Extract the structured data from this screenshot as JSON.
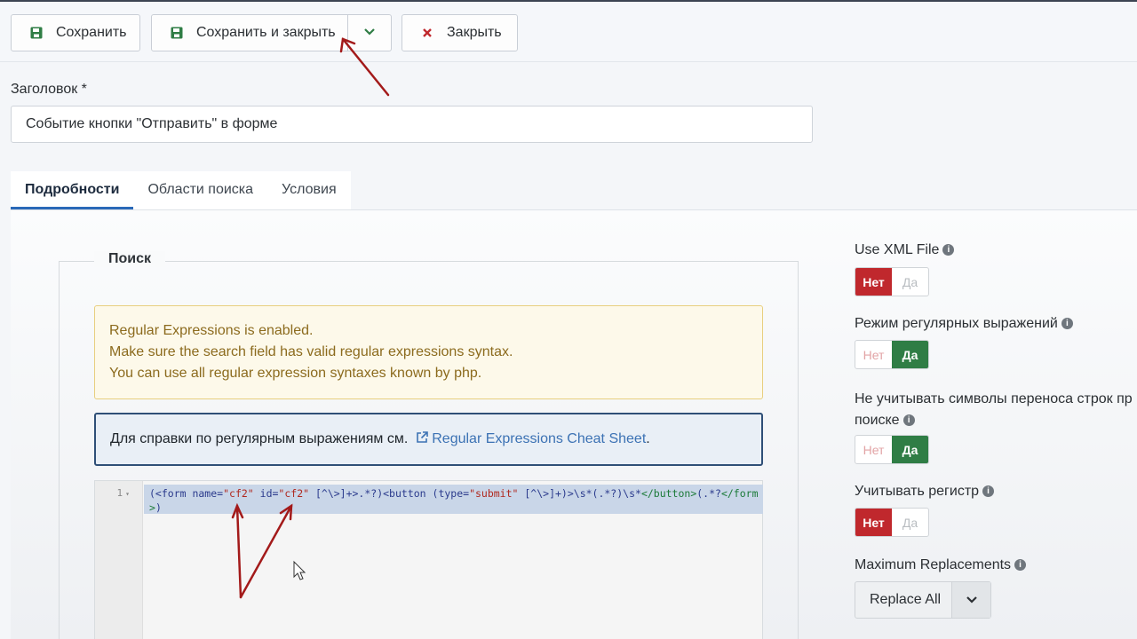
{
  "toolbar": {
    "save_label": "Сохранить",
    "save_close_label": "Сохранить и закрыть",
    "close_label": "Закрыть"
  },
  "title_field": {
    "label": "Заголовок *",
    "value": "Событие кнопки \"Отправить\" в форме"
  },
  "tabs": [
    {
      "label": "Подробности",
      "active": true
    },
    {
      "label": "Области поиска",
      "active": false
    },
    {
      "label": "Условия",
      "active": false
    }
  ],
  "search_fieldset": {
    "legend": "Поиск",
    "warning_lines": [
      "Regular Expressions is enabled.",
      "Make sure the search field has valid regular expressions syntax.",
      "You can use all regular expression syntaxes known by php."
    ],
    "info_text": "Для справки по регулярным выражениям см.",
    "info_link": "Regular Expressions Cheat Sheet",
    "info_after": "."
  },
  "editor": {
    "line_number": "1",
    "code": "(<form name=\"cf2\" id=\"cf2\" [^\\>]+>.*?)<button (type=\"submit\" [^\\>]+)>\\s*(.*?)\\s*</button>(.*?</form>)"
  },
  "options": {
    "use_xml_file": {
      "label": "Use XML File",
      "no": "Нет",
      "yes": "Да",
      "value": "no"
    },
    "regex_mode": {
      "label": "Режим регулярных выражений",
      "no": "Нет",
      "yes": "Да",
      "value": "yes"
    },
    "ignore_linebreaks": {
      "label_line1": "Не учитывать символы переноса строк пр",
      "label_line2": "поиске",
      "no": "Нет",
      "yes": "Да",
      "value": "yes"
    },
    "case_sensitive": {
      "label": "Учитывать регистр",
      "no": "Нет",
      "yes": "Да",
      "value": "no"
    },
    "max_replacements": {
      "label": "Maximum Replacements",
      "value": "Replace All"
    }
  },
  "colors": {
    "danger": "#c0282d",
    "success": "#2f7d45",
    "accent": "#2a69b8",
    "annotation_arrow": "#a31a1a"
  }
}
